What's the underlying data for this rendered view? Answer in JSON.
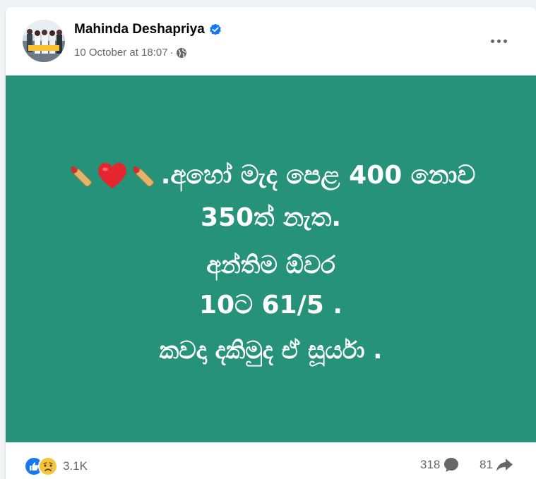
{
  "post": {
    "author": "Mahinda Deshapriya",
    "timestamp": "10 October at 18:07",
    "meta_separator": "·",
    "audience_icon": "globe-icon",
    "verified_icon": "verified-badge-icon"
  },
  "content": {
    "background_color": "#27927a",
    "line1_text": ".අහෝ මැද පෙළ 400 නොව",
    "line1_emojis": [
      "cricket-bat-icon",
      "heart-icon",
      "cricket-bat-icon"
    ],
    "line2": "350ත් නැත.",
    "line3": "අන්තිම ඕවර",
    "line4": "10ට 61/5 .",
    "line5": "කවදා දකිමුද ඒ සූර්යා ."
  },
  "footer": {
    "reaction_icons": [
      "like-icon",
      "sad-icon"
    ],
    "reaction_count": "3.1K",
    "comments_count": "318",
    "shares_count": "81"
  },
  "colors": {
    "accent": "#1877f2",
    "text_primary": "#050505",
    "text_secondary": "#65676b"
  }
}
